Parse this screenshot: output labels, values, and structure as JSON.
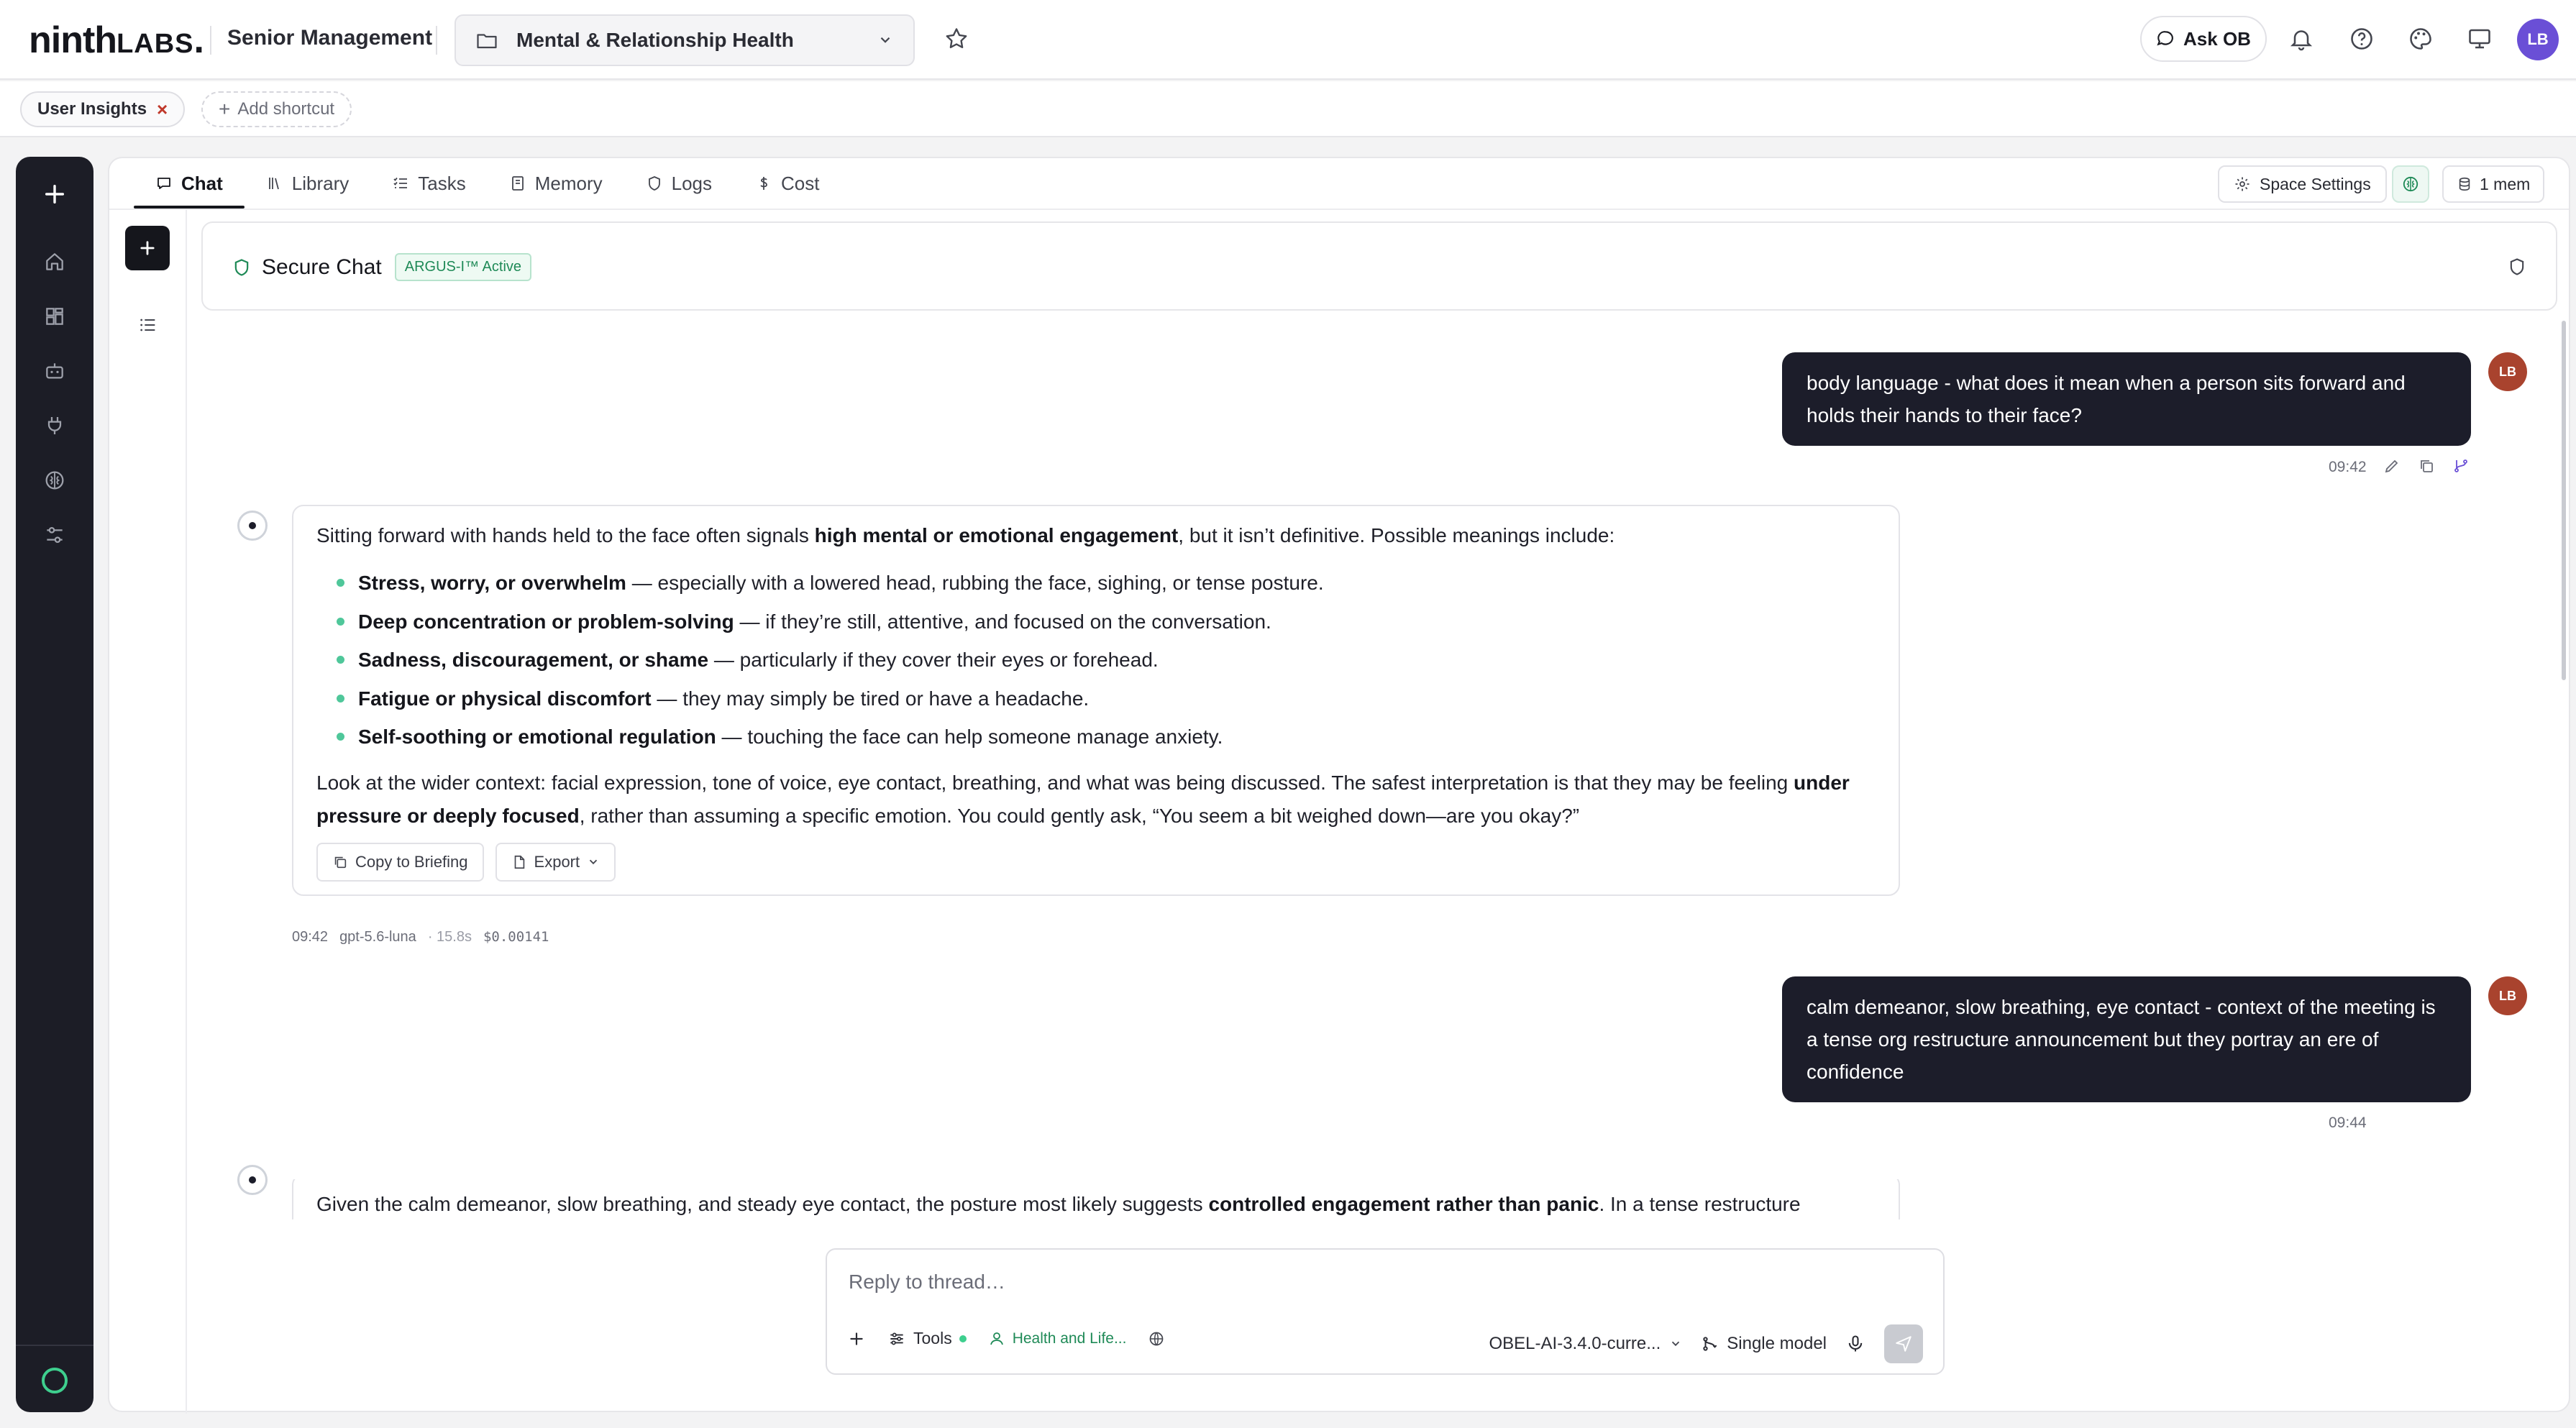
{
  "brand": {
    "logo_main": "ninth",
    "logo_tail": "LABS",
    "logo_dot": "."
  },
  "header": {
    "org": "Senior Management",
    "space": "Mental & Relationship Health",
    "ask_label": "Ask OB",
    "avatar": "LB"
  },
  "shortcuts": {
    "active": "User Insights",
    "add": "Add shortcut"
  },
  "tabs": [
    {
      "label": "Chat",
      "icon": "chat-icon"
    },
    {
      "label": "Library",
      "icon": "library-icon"
    },
    {
      "label": "Tasks",
      "icon": "tasks-icon"
    },
    {
      "label": "Memory",
      "icon": "memory-icon"
    },
    {
      "label": "Logs",
      "icon": "shield-icon"
    },
    {
      "label": "Cost",
      "icon": "dollar-icon"
    }
  ],
  "toolbar": {
    "space_settings": "Space Settings",
    "memory": "1 mem"
  },
  "chat": {
    "title": "Secure Chat",
    "badge": "ARGUS-I™ Active"
  },
  "messages": {
    "u1": {
      "text": "body language - what does it mean when a person sits forward and holds their hands to their face?",
      "time": "09:42",
      "avatar": "LB"
    },
    "b1": {
      "intro_a": "Sitting forward with hands held to the face often signals ",
      "intro_b": "high mental or emotional engagement",
      "intro_c": ", but it isn’t definitive. Possible meanings include:",
      "bullets": [
        {
          "bold": "Stress, worry, or overwhelm",
          "rest": " — especially with a lowered head, rubbing the face, sighing, or tense posture."
        },
        {
          "bold": "Deep concentration or problem-solving",
          "rest": " — if they’re still, attentive, and focused on the conversation."
        },
        {
          "bold": "Sadness, discouragement, or shame",
          "rest": " — particularly if they cover their eyes or forehead."
        },
        {
          "bold": "Fatigue or physical discomfort",
          "rest": " — they may simply be tired or have a headache."
        },
        {
          "bold": "Self-soothing or emotional regulation",
          "rest": " — touching the face can help someone manage anxiety."
        }
      ],
      "outro_a": "Look at the wider context: facial expression, tone of voice, eye contact, breathing, and what was being discussed. The safest interpretation is that they may be feeling ",
      "outro_b": "under pressure or deeply focused",
      "outro_c": ", rather than assuming a specific emotion. You could gently ask, “You seem a bit weighed down—are you okay?”",
      "copy_btn": "Copy to Briefing",
      "export_btn": "Export",
      "time": "09:42",
      "model": "gpt-5.6-luna",
      "latency": "· 15.8s",
      "cost": "$0.00141"
    },
    "u2": {
      "text": "calm demeanor, slow breathing, eye contact - context of the meeting is a tense org restructure announcement but they portray an ere of confidence",
      "time": "09:44",
      "avatar": "LB"
    },
    "b2": {
      "text_a": "Given the calm demeanor, slow breathing, and steady eye contact, the posture most likely suggests ",
      "text_b": "controlled engagement rather than panic",
      "text_c": ". In a tense restructure"
    }
  },
  "composer": {
    "placeholder": "Reply to thread…",
    "tools": "Tools",
    "persona": "Health and Life...",
    "model": "OBEL-AI-3.4.0-curre...",
    "mode": "Single model"
  },
  "colors": {
    "accent_green": "#3ecf8e",
    "dark": "#1c1d2a",
    "avatar_purple": "#6a4fd6",
    "user_avatar": "#a9432e"
  }
}
